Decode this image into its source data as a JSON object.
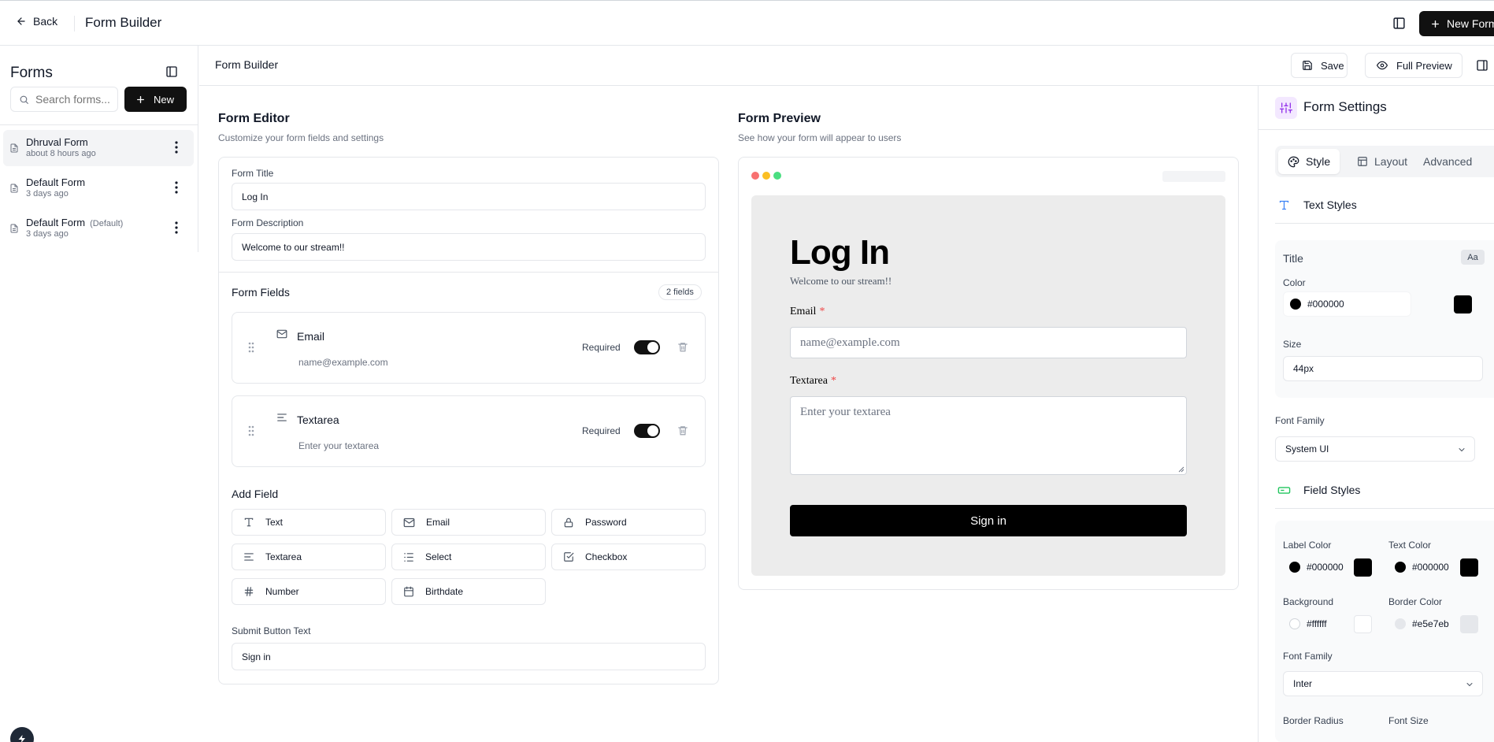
{
  "topbar": {
    "back_label": "Back",
    "title": "Form Builder",
    "new_form_label": "New Form"
  },
  "sidebar": {
    "title": "Forms",
    "search_placeholder": "Search forms...",
    "new_label": "New",
    "forms": [
      {
        "name": "Dhruval Form",
        "tag": "",
        "updated": "about 8 hours ago",
        "active": true
      },
      {
        "name": "Default Form",
        "tag": "",
        "updated": "3 days ago",
        "active": false
      },
      {
        "name": "Default Form",
        "tag": "(Default)",
        "updated": "3 days ago",
        "active": false
      }
    ]
  },
  "main": {
    "title": "Form Builder",
    "save_label": "Save",
    "full_preview_label": "Full Preview"
  },
  "editor": {
    "title": "Form Editor",
    "subtitle": "Customize your form fields and settings",
    "form_title_label": "Form Title",
    "form_title_value": "Log In",
    "form_description_label": "Form Description",
    "form_description_value": "Welcome to our stream!!",
    "fields_title": "Form Fields",
    "fields_count": "2 fields",
    "fields": [
      {
        "name": "Email",
        "placeholder": "name@example.com",
        "required_label": "Required",
        "required": true,
        "icon": "mail-icon"
      },
      {
        "name": "Textarea",
        "placeholder": "Enter your textarea",
        "required_label": "Required",
        "required": true,
        "icon": "align-left-icon"
      }
    ],
    "add_field_title": "Add Field",
    "add_field_types": [
      {
        "label": "Text",
        "icon": "type-icon"
      },
      {
        "label": "Email",
        "icon": "mail-icon"
      },
      {
        "label": "Password",
        "icon": "lock-icon"
      },
      {
        "label": "Textarea",
        "icon": "align-left-icon"
      },
      {
        "label": "Select",
        "icon": "list-icon"
      },
      {
        "label": "Checkbox",
        "icon": "checkbox-icon"
      },
      {
        "label": "Number",
        "icon": "hash-icon"
      },
      {
        "label": "Birthdate",
        "icon": "calendar-icon"
      }
    ],
    "submit_label": "Submit Button Text",
    "submit_value": "Sign in"
  },
  "preview": {
    "title": "Form Preview",
    "subtitle": "See how your form will appear to users",
    "form_title": "Log In",
    "form_description": "Welcome to our stream!!",
    "email_label": "Email",
    "email_placeholder": "name@example.com",
    "textarea_label": "Textarea",
    "textarea_placeholder": "Enter your textarea",
    "required_mark": "*",
    "submit_label": "Sign in"
  },
  "settings": {
    "title": "Form Settings",
    "tabs": [
      {
        "label": "Style",
        "icon": "palette-icon",
        "active": true
      },
      {
        "label": "Layout",
        "icon": "layout-icon",
        "active": false
      },
      {
        "label": "Advanced",
        "icon": "",
        "active": false
      }
    ],
    "text_styles": {
      "heading": "Text Styles",
      "title_label": "Title",
      "aa_label": "Aa",
      "color_label": "Color",
      "color_value": "#000000",
      "size_label": "Size",
      "size_value": "44px",
      "font_family_label": "Font Family",
      "font_family_value": "System UI"
    },
    "field_styles": {
      "heading": "Field Styles",
      "label_color_label": "Label Color",
      "label_color_value": "#000000",
      "text_color_label": "Text Color",
      "text_color_value": "#000000",
      "background_label": "Background",
      "background_value": "#ffffff",
      "border_color_label": "Border Color",
      "border_color_value": "#e5e7eb",
      "font_family_label": "Font Family",
      "font_family_value": "Inter",
      "border_radius_label": "Border Radius",
      "font_size_label": "Font Size"
    }
  },
  "colors": {
    "primary": "#111111",
    "muted_text": "#6b7280",
    "border": "#e5e7eb",
    "dot_red": "#f87171",
    "dot_yellow": "#fbbf24",
    "dot_green": "#4ade80"
  }
}
